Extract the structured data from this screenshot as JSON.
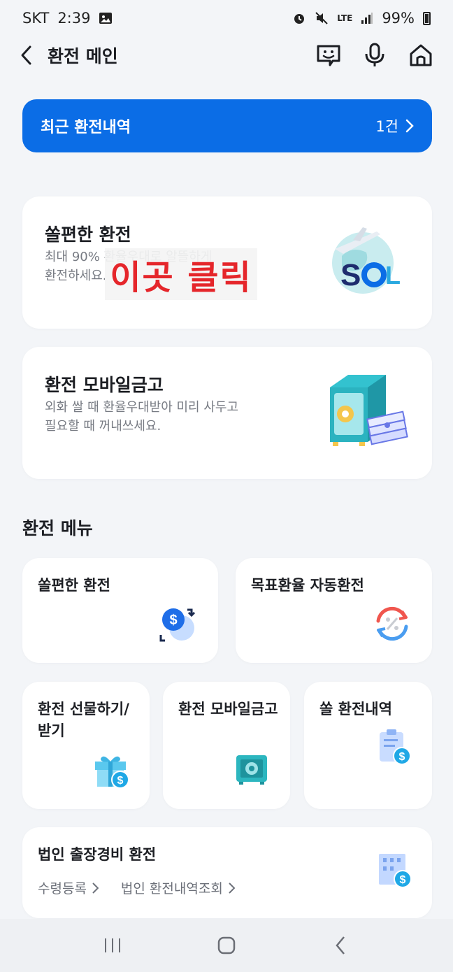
{
  "status_bar": {
    "carrier": "SKT",
    "time": "2:39",
    "network": "LTE",
    "battery": "99%"
  },
  "header": {
    "title": "환전 메인",
    "icons": [
      "back-icon",
      "chatbot-icon",
      "mic-icon",
      "home-icon"
    ]
  },
  "recent": {
    "title": "최근 환전내역",
    "count": "1건"
  },
  "cards": {
    "easy_exchange": {
      "title": "쏠편한 환전",
      "desc_line1": "최대 90% 환율우대로 알뜰하게",
      "desc_line2": "환전하세요."
    },
    "mobile_safe": {
      "title": "환전 모바일금고",
      "desc_line1": "외화 쌀 때 환율우대받아 미리 사두고",
      "desc_line2": "필요할 때 꺼내쓰세요."
    }
  },
  "overlay": {
    "text": "이곳 클릭"
  },
  "menu": {
    "section_title": "환전 메뉴",
    "items": [
      {
        "label": "쏠편한 환전",
        "icon": "dollar-exchange-icon"
      },
      {
        "label": "목표환율 자동환전",
        "icon": "percent-cycle-icon"
      },
      {
        "label": "환전 선물하기/받기",
        "icon": "gift-dollar-icon"
      },
      {
        "label": "환전 모바일금고",
        "icon": "safe-icon"
      },
      {
        "label": "쏠 환전내역",
        "icon": "clipboard-dollar-icon"
      }
    ],
    "corporate": {
      "title": "법인 출장경비 환전",
      "link1": "수령등록",
      "link2": "법인 환전내역조회",
      "icon": "building-dollar-icon"
    }
  },
  "colors": {
    "primary": "#0b6de6",
    "background": "#f3f5f8",
    "overlay_text": "#e5262b"
  }
}
